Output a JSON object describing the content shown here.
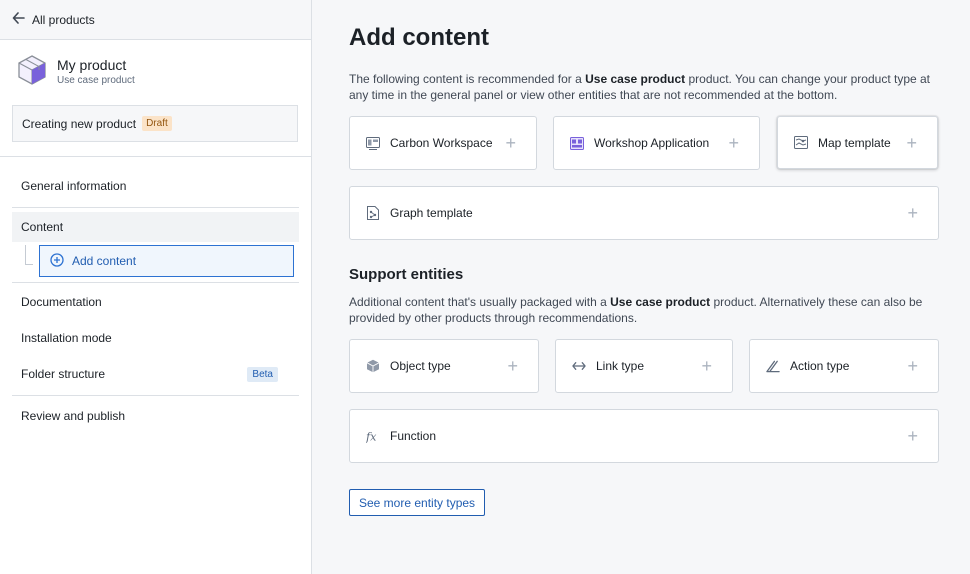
{
  "sidebar": {
    "back_label": "All products",
    "product_name": "My product",
    "product_type": "Use case product",
    "status_label": "Creating new product",
    "draft_badge": "Draft",
    "nav": {
      "general": "General information",
      "content": "Content",
      "add_content": "Add content",
      "documentation": "Documentation",
      "installation": "Installation mode",
      "folder": "Folder structure",
      "beta_badge": "Beta",
      "review": "Review and publish"
    }
  },
  "main": {
    "title": "Add content",
    "intro_pre": "The following content is recommended for a ",
    "intro_bold": "Use case product",
    "intro_post": " product. You can change your product type at any time in the general panel or view other entities that are not recommended at the bottom.",
    "content_cards": [
      "Carbon Workspace",
      "Workshop Application",
      "Map template",
      "Graph template"
    ],
    "support_title": "Support entities",
    "support_pre": "Additional content that's usually packaged with a ",
    "support_bold": "Use case product",
    "support_post": " product. Alternatively these can also be provided by other products through recommendations.",
    "support_cards": [
      "Object type",
      "Link type",
      "Action type",
      "Function"
    ],
    "more_button": "See more entity types",
    "plus": "+"
  },
  "colors": {
    "accent": "#2d72d2",
    "accent_text": "#215db0",
    "draft_bg": "#fbe3c8",
    "beta_bg": "#dfeaf6",
    "product_icon": "#7961db"
  },
  "icons": {
    "back": "arrow-left-icon",
    "product": "cube-icon",
    "add": "plus-circle-icon",
    "carbon": "carbon-workspace-icon",
    "workshop": "workshop-icon",
    "map": "map-icon",
    "graph": "graph-icon",
    "object": "cube-icon",
    "link": "arrows-horizontal-icon",
    "action": "action-icon",
    "function": "function-icon"
  }
}
